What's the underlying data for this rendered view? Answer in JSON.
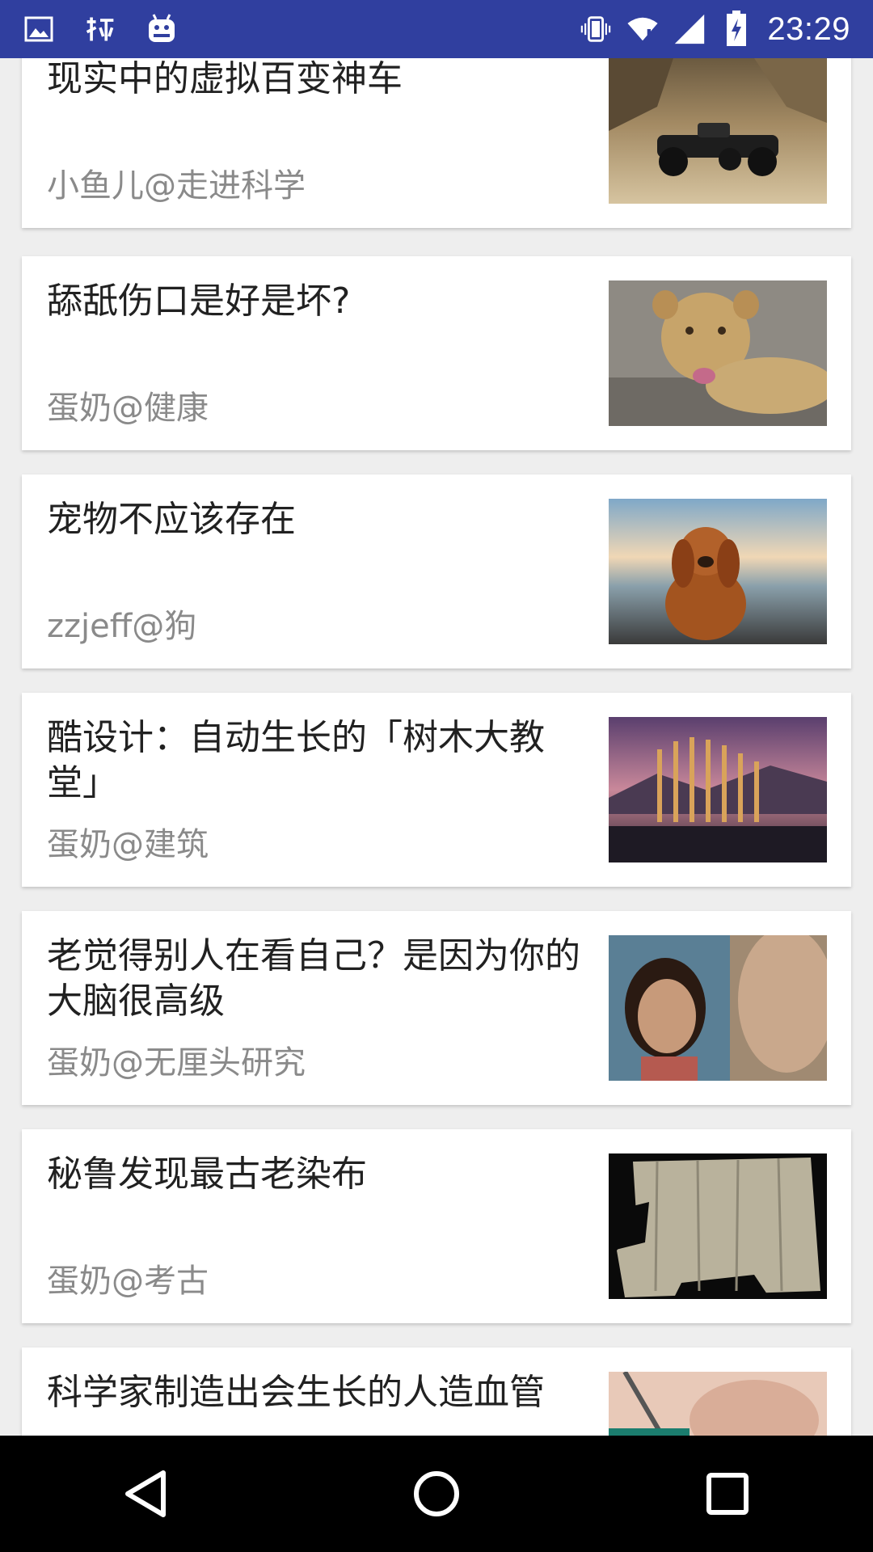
{
  "status_bar": {
    "time": "23:29",
    "left_icons": [
      "image-icon",
      "shrimp-app-icon",
      "android-icon"
    ],
    "right_icons": [
      "vibrate-icon",
      "wifi-icon",
      "signal-icon",
      "battery-charging-icon"
    ],
    "bg_color": "#303f9f"
  },
  "feed": {
    "items": [
      {
        "title": "现实中的虚拟百变神车",
        "meta": "小鱼儿@走进科学",
        "thumbnail": "car-photo"
      },
      {
        "title": "舔舐伤口是好是坏?",
        "meta": "蛋奶@健康",
        "thumbnail": "lion-cub-photo"
      },
      {
        "title": "宠物不应该存在",
        "meta": "zzjeff@狗",
        "thumbnail": "dog-photo"
      },
      {
        "title": "酷设计：自动生长的「树木大教堂」",
        "meta": "蛋奶@建筑",
        "thumbnail": "tree-cathedral-photo"
      },
      {
        "title": "老觉得别人在看自己？是因为你的大脑很高级",
        "meta": "蛋奶@无厘头研究",
        "thumbnail": "faces-photo"
      },
      {
        "title": "秘鲁发现最古老染布",
        "meta": "蛋奶@考古",
        "thumbnail": "ancient-cloth-photo"
      },
      {
        "title": "科学家制造出会生长的人造血管",
        "meta": "",
        "thumbnail": "surgery-photo"
      }
    ]
  },
  "nav_bar": {
    "buttons": [
      "back-icon",
      "home-icon",
      "recents-icon"
    ]
  }
}
